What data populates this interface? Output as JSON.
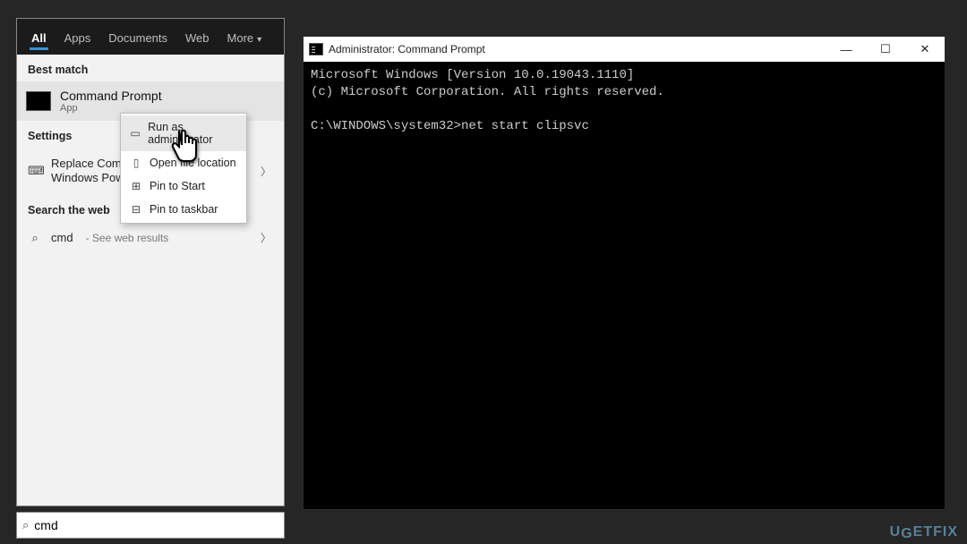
{
  "search": {
    "tabs": [
      "All",
      "Apps",
      "Documents",
      "Web",
      "More"
    ],
    "best_match_header": "Best match",
    "best_match": {
      "title": "Command Prompt",
      "subtitle": "App"
    },
    "settings_header": "Settings",
    "settings_row": "Replace Command Prompt with Windows PowerShell",
    "settings_row_visible": "Replace Comm…\nWindows Pow…",
    "web_header": "Search the web",
    "web_row": {
      "query": "cmd",
      "suffix": "See web results"
    },
    "input_value": "cmd"
  },
  "context_menu": {
    "items": [
      "Run as administrator",
      "Open file location",
      "Pin to Start",
      "Pin to taskbar"
    ]
  },
  "cmd_window": {
    "title": "Administrator: Command Prompt",
    "lines": [
      "Microsoft Windows [Version 10.0.19043.1110]",
      "(c) Microsoft Corporation. All rights reserved.",
      "",
      "C:\\WINDOWS\\system32>net start clipsvc"
    ]
  },
  "watermark": "UGETFIX"
}
